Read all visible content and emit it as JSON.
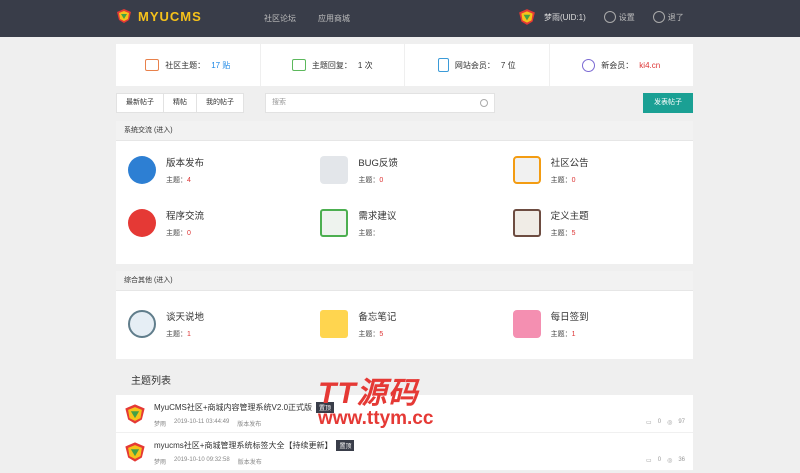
{
  "header": {
    "logo_text": "MYUCMS",
    "nav": [
      "社区论坛",
      "应用商城"
    ],
    "user_name": "梦雨(UID:1)",
    "settings_label": "设置",
    "logout_label": "退了"
  },
  "stats": [
    {
      "label": "社区主题：",
      "value": "17 贴",
      "icon": "bookmark-icon",
      "color": "#e8814b"
    },
    {
      "label": "主题回复：",
      "value": "1 次",
      "icon": "folder-icon",
      "color": "#5cb85c"
    },
    {
      "label": "网站会员：",
      "value": "7 位",
      "icon": "document-icon",
      "color": "#3b9bd8"
    },
    {
      "label": "新会员：",
      "value": "ki4.cn",
      "icon": "atom-icon",
      "color": "#7b6ad3"
    }
  ],
  "toolbar": {
    "tabs": [
      "最新帖子",
      "精帖",
      "我的帖子"
    ],
    "search_placeholder": "搜索",
    "post_button": "发表帖子"
  },
  "sections": [
    {
      "title": "系统交流 (进入)",
      "forums": [
        {
          "name": "版本发布",
          "count_label": "主题：",
          "count": "4",
          "icon": "globe-hand-icon"
        },
        {
          "name": "BUG反馈",
          "count_label": "主题：",
          "count": "0",
          "icon": "pencil-note-icon"
        },
        {
          "name": "社区公告",
          "count_label": "主题：",
          "count": "0",
          "icon": "calendar-icon"
        },
        {
          "name": "程序交流",
          "count_label": "主题：",
          "count": "0",
          "icon": "target-icon"
        },
        {
          "name": "需求建议",
          "count_label": "主题：",
          "count": "",
          "icon": "receipt-icon"
        },
        {
          "name": "定义主题",
          "count_label": "主题：",
          "count": "5",
          "icon": "bank-icon"
        }
      ]
    },
    {
      "title": "综合其他 (进入)",
      "forums": [
        {
          "name": "谈天说地",
          "count_label": "主题：",
          "count": "1",
          "icon": "cloud-icon"
        },
        {
          "name": "备忘笔记",
          "count_label": "主题：",
          "count": "5",
          "icon": "notes-icon"
        },
        {
          "name": "每日签到",
          "count_label": "主题：",
          "count": "1",
          "icon": "chat-icon"
        }
      ]
    }
  ],
  "topic_list": {
    "title": "主题列表",
    "topics": [
      {
        "title": "MyuCMS社区+商城内容管理系统V2.0正式版",
        "badge": "置顶",
        "author": "梦雨",
        "time": "2019-10-11 03:44:49",
        "forum": "版本发布",
        "replies": "0",
        "views": "97"
      },
      {
        "title": "myucms社区+商城管理系统标签大全【持续更新】",
        "badge": "置顶",
        "author": "梦雨",
        "time": "2019-10-10 09:32:58",
        "forum": "版本发布",
        "replies": "0",
        "views": "36"
      }
    ]
  },
  "watermark": {
    "line1": "TT源码",
    "line2": "www.ttym.cc"
  }
}
